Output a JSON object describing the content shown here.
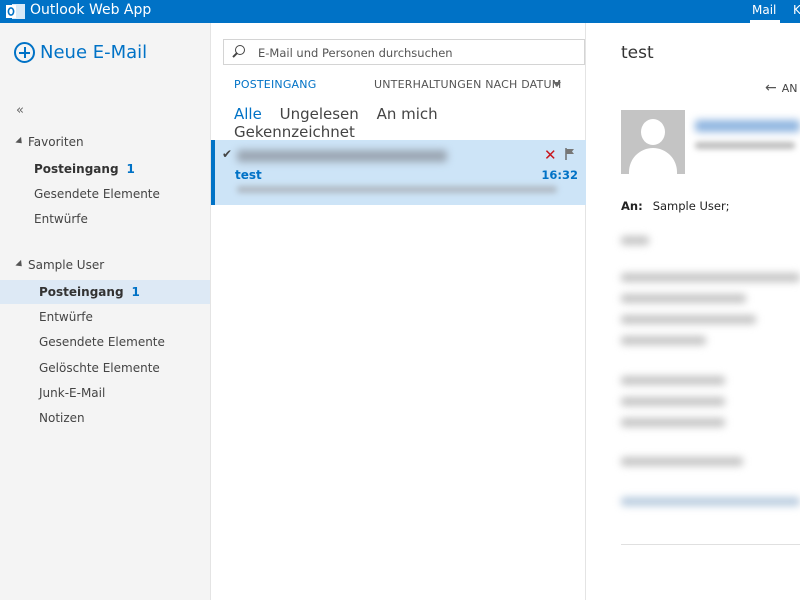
{
  "topbar": {
    "app_title": "Outlook Web App",
    "mail_tab": "Mail",
    "next_tab_partial": "K",
    "accent": "#0072c6"
  },
  "leftnav": {
    "new_mail_label": "Neue E-Mail",
    "collapse_glyph": "«",
    "favorites": {
      "label": "Favoriten",
      "items": [
        {
          "label": "Posteingang",
          "count": "1"
        },
        {
          "label": "Gesendete Elemente",
          "count": ""
        },
        {
          "label": "Entwürfe",
          "count": ""
        }
      ]
    },
    "account": {
      "label": "Sample User",
      "items": [
        {
          "label": "Posteingang",
          "count": "1"
        },
        {
          "label": "Entwürfe",
          "count": ""
        },
        {
          "label": "Gesendete Elemente",
          "count": ""
        },
        {
          "label": "Gelöschte Elemente",
          "count": ""
        },
        {
          "label": "Junk-E-Mail",
          "count": ""
        },
        {
          "label": "Notizen",
          "count": ""
        }
      ]
    }
  },
  "list": {
    "search_placeholder": "E-Mail und Personen durchsuchen",
    "folder_label": "POSTEINGANG",
    "sort_label": "UNTERHALTUNGEN NACH DATUM",
    "filters": [
      "Alle",
      "Ungelesen",
      "An mich",
      "Gekennzeichnet"
    ],
    "messages": [
      {
        "subject": "test",
        "time": "16:32"
      }
    ]
  },
  "reading": {
    "subject": "test",
    "reply_label": "AN",
    "to_label": "An:",
    "to_value": "Sample User;"
  },
  "icons": {
    "search": "search-icon",
    "new_mail": "plus-circle-icon",
    "delete": "delete-x-icon",
    "flag": "flag-icon",
    "reply": "reply-arrow-icon",
    "avatar": "person-placeholder-icon"
  }
}
